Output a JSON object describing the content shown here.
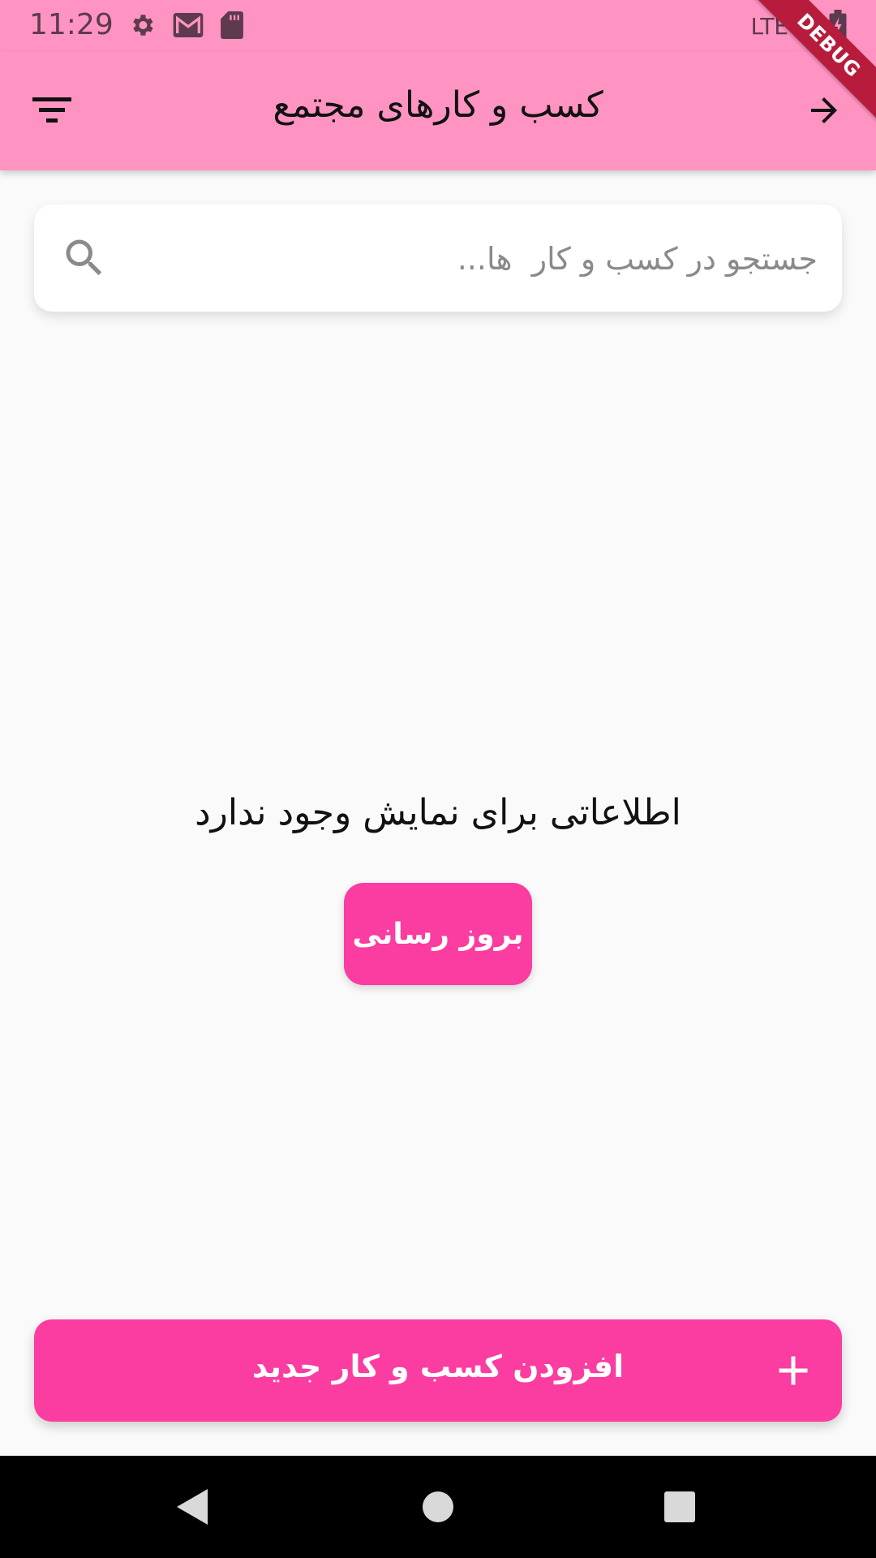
{
  "status_bar": {
    "time": "11:29",
    "network": "LTE",
    "icons": [
      "settings-icon",
      "gmail-icon",
      "sd-card-icon",
      "signal-icon",
      "battery-charging-icon"
    ]
  },
  "debug_banner": "DEBUG",
  "app_bar": {
    "title": "کسب و کارهای مجتمع",
    "left_icon": "filter-icon",
    "right_icon": "arrow-right-icon"
  },
  "search": {
    "placeholder": "جستجو در کسب و کار  ها...",
    "value": "",
    "icon": "search-icon"
  },
  "empty_state": {
    "message": "اطلاعاتی برای نمایش وجود ندارد",
    "refresh_label": "بروز رسانی"
  },
  "add_button": {
    "label": "افزودن کسب و کار  جدید",
    "icon": "plus-icon"
  },
  "nav_bar": {
    "icons": [
      "back-triangle-icon",
      "home-circle-icon",
      "recents-square-icon"
    ]
  },
  "colors": {
    "app_bar": "#ff94c2",
    "accent": "#fb3ca0",
    "background": "#fafafa",
    "nav_bar": "#000000",
    "debug_banner": "#b71c3c"
  }
}
